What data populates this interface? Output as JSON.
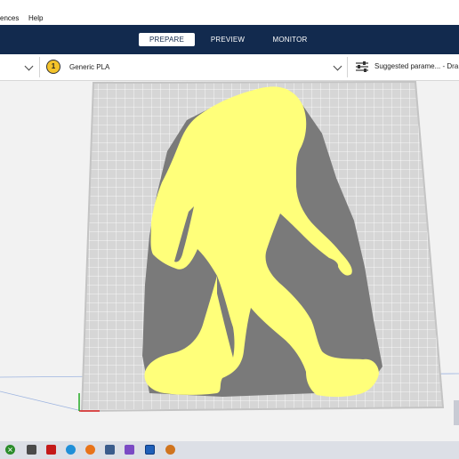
{
  "menu": {
    "item_1": "ences",
    "item_2": "Help"
  },
  "stages": [
    "PREPARE",
    "PREVIEW",
    "MONITOR"
  ],
  "toolbar": {
    "extruder_number": "1",
    "material": "Generic PLA",
    "print_settings": "Suggested parame... - Dra"
  },
  "colors": {
    "header": "#122a4e",
    "model": "#ffff7a",
    "shadow": "#7a7a7a",
    "build_plate": "#d6d6d6",
    "grid": "#ffffff",
    "extruder": "#f4c32a"
  },
  "icons": {
    "dropdown": "chevron-down-icon",
    "settings": "sliders-icon",
    "extruder": "extruder-icon"
  },
  "taskbar_icons": [
    "start-icon",
    "edge-icon",
    "app-icon",
    "firefox-icon",
    "files-icon",
    "app-icon",
    "app-icon",
    "cura-icon",
    "app-icon"
  ]
}
